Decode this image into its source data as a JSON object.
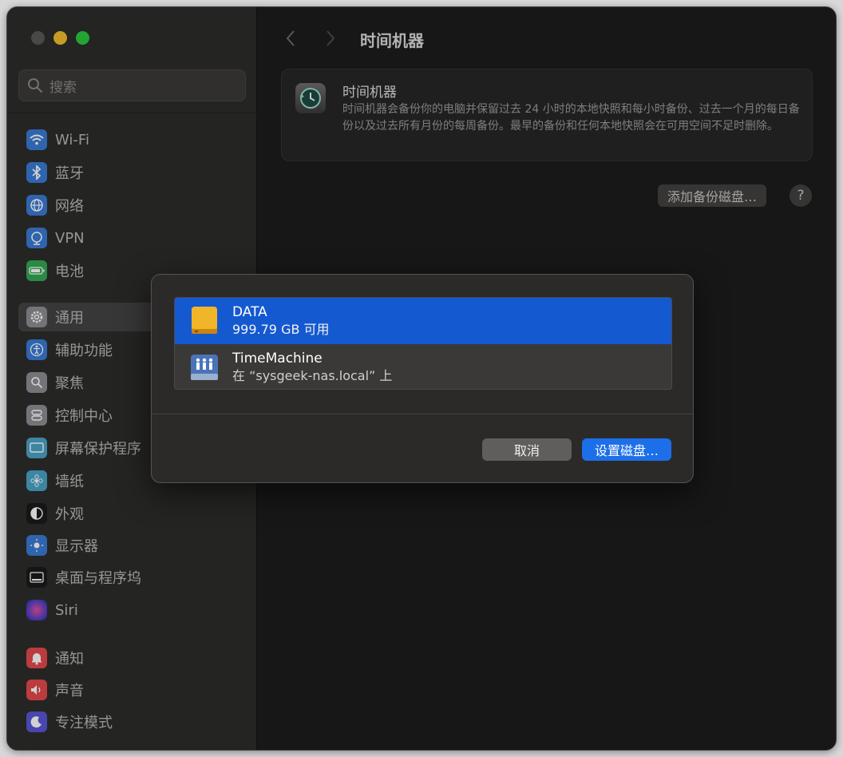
{
  "sidebar": {
    "search_placeholder": "搜索",
    "items": [
      {
        "label": "Wi-Fi",
        "icon": "wifi-icon",
        "color": "#3a7bd5"
      },
      {
        "label": "蓝牙",
        "icon": "bluetooth-icon",
        "color": "#3a7bd5"
      },
      {
        "label": "网络",
        "icon": "globe-icon",
        "color": "#3a7bd5"
      },
      {
        "label": "VPN",
        "icon": "vpn-icon",
        "color": "#3a7bd5"
      },
      {
        "label": "电池",
        "icon": "battery-icon",
        "color": "#34a853"
      },
      {
        "label": "通用",
        "icon": "gear-icon",
        "color": "#8e8e93"
      },
      {
        "label": "辅助功能",
        "icon": "accessibility-icon",
        "color": "#3a7bd5"
      },
      {
        "label": "聚焦",
        "icon": "spotlight-icon",
        "color": "#8e8e93"
      },
      {
        "label": "控制中心",
        "icon": "control-center-icon",
        "color": "#8e8e93"
      },
      {
        "label": "屏幕保护程序",
        "icon": "screensaver-icon",
        "color": "#4aa3c7"
      },
      {
        "label": "墙纸",
        "icon": "wallpaper-icon",
        "color": "#4aa3c7"
      },
      {
        "label": "外观",
        "icon": "appearance-icon",
        "color": "#1a1a1a"
      },
      {
        "label": "显示器",
        "icon": "display-icon",
        "color": "#3a7bd5"
      },
      {
        "label": "桌面与程序坞",
        "icon": "dock-icon",
        "color": "#1a1a1a"
      },
      {
        "label": "Siri",
        "icon": "siri-icon",
        "color": "#6b4fbb"
      },
      {
        "label": "通知",
        "icon": "bell-icon",
        "color": "#e5484d"
      },
      {
        "label": "声音",
        "icon": "speaker-icon",
        "color": "#e5484d"
      },
      {
        "label": "专注模式",
        "icon": "moon-icon",
        "color": "#5856d6"
      }
    ]
  },
  "main": {
    "title": "时间机器",
    "info_title": "时间机器",
    "info_desc": "时间机器会备份你的电脑并保留过去 24 小时的本地快照和每小时备份、过去一个月的每日备份以及过去所有月份的每周备份。最早的备份和任何本地快照会在可用空间不足时删除。",
    "add_button": "添加备份磁盘…",
    "help_button": "?"
  },
  "dialog": {
    "disks": [
      {
        "name": "DATA",
        "detail": "999.79 GB 可用",
        "icon": "external-drive-icon",
        "selected": true
      },
      {
        "name": "TimeMachine",
        "detail": "在 “sysgeek-nas.local” 上",
        "icon": "network-drive-icon",
        "selected": false
      }
    ],
    "cancel_label": "取消",
    "ok_label": "设置磁盘…"
  },
  "colors": {
    "accent": "#1559d0",
    "button_blue": "#1c6fe8"
  }
}
